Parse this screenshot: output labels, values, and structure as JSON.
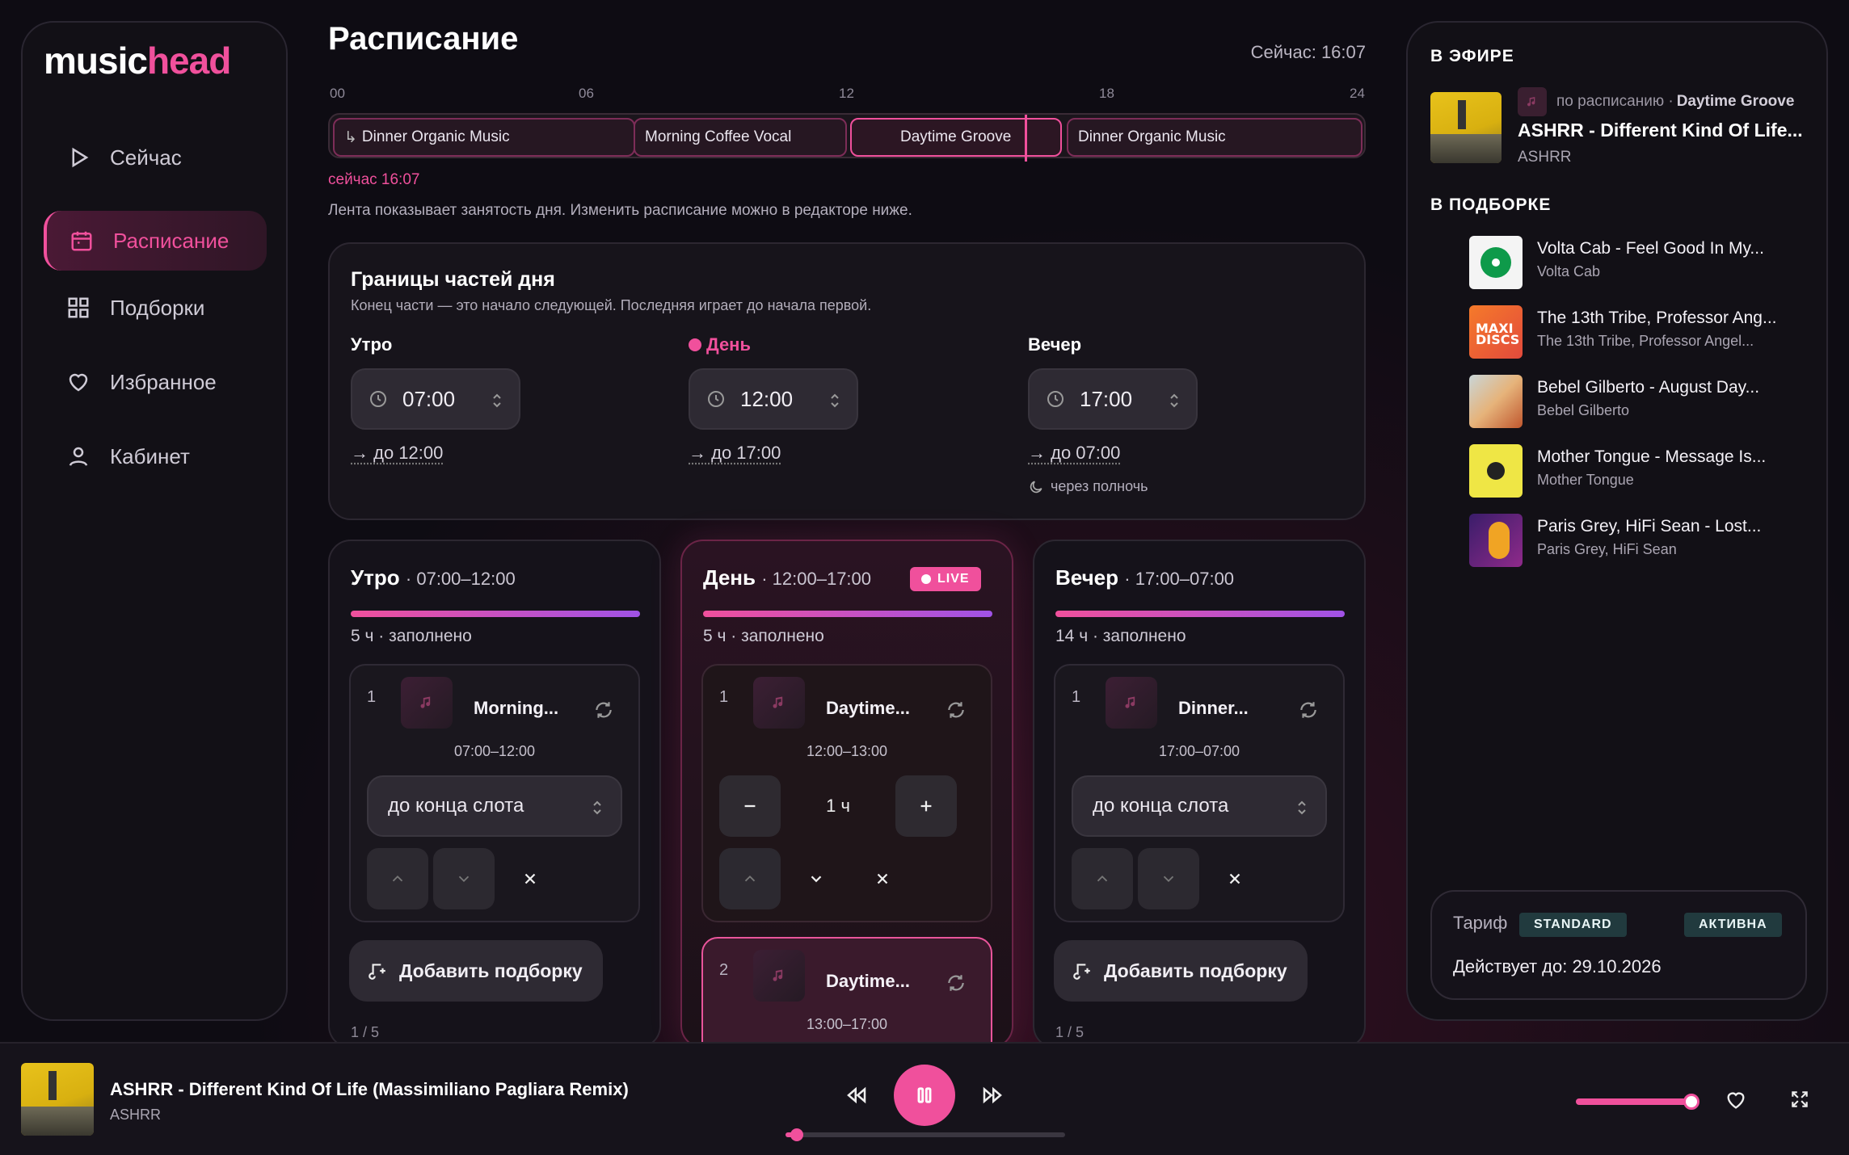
{
  "app": {
    "logo_main": "music",
    "logo_accent": "head"
  },
  "sidebar": {
    "items": [
      {
        "label": "Сейчас",
        "icon": "play-icon"
      },
      {
        "label": "Расписание",
        "icon": "calendar-icon",
        "active": true
      },
      {
        "label": "Подборки",
        "icon": "grid-icon"
      },
      {
        "label": "Избранное",
        "icon": "heart-icon"
      },
      {
        "label": "Кабинет",
        "icon": "user-icon"
      }
    ]
  },
  "header": {
    "title": "Расписание",
    "now": "Сейчас: 16:07"
  },
  "timeline": {
    "ticks": [
      "00",
      "06",
      "12",
      "18",
      "24"
    ],
    "segments": [
      "Dinner Organic Music",
      "Morning Coffee Vocal",
      "Daytime Groove",
      "Dinner Organic Music"
    ],
    "now_label": "сейчас 16:07",
    "hint": "Лента показывает занятость дня. Изменить расписание можно в редакторе ниже.",
    "now_hours": 16.12
  },
  "bounds": {
    "title": "Границы частей дня",
    "subtitle": "Конец части — это начало следующей. Последняя играет до начала первой.",
    "parts": [
      {
        "label": "Утро",
        "time": "07:00",
        "till": "→ до 12:00"
      },
      {
        "label": "День",
        "time": "12:00",
        "till": "→ до 17:00",
        "current": true
      },
      {
        "label": "Вечер",
        "time": "17:00",
        "till": "→ до 07:00",
        "note": "через полночь"
      }
    ]
  },
  "columns": [
    {
      "title": "Утро",
      "range": "· 07:00–12:00",
      "filled": "5 ч · заполнено",
      "item": {
        "num": "1",
        "name": "Morning...",
        "time": "07:00–12:00",
        "select": "до конца слота"
      },
      "add": "Добавить подборку",
      "count": "1 / 5"
    },
    {
      "title": "День",
      "range": "· 12:00–17:00",
      "live": "LIVE",
      "filled": "5 ч · заполнено",
      "item": {
        "num": "1",
        "name": "Daytime...",
        "time": "12:00–13:00",
        "duration": "1 ч"
      },
      "item2": {
        "num": "2",
        "name": "Daytime...",
        "time": "13:00–17:00"
      }
    },
    {
      "title": "Вечер",
      "range": "· 17:00–07:00",
      "filled": "14 ч · заполнено",
      "item": {
        "num": "1",
        "name": "Dinner...",
        "time": "17:00–07:00",
        "select": "до конца слота"
      },
      "add": "Добавить подборку",
      "count": "1 / 5"
    }
  ],
  "on_air": {
    "heading": "В ЭФИРЕ",
    "source_prefix": "по расписанию · ",
    "source": "Daytime Groove",
    "title": "ASHRR - Different Kind Of Life...",
    "artist": "ASHRR"
  },
  "collection": {
    "heading": "В ПОДБОРКЕ",
    "tracks": [
      {
        "title": "Volta Cab - Feel Good In My...",
        "artist": "Volta Cab"
      },
      {
        "title": "The 13th Tribe, Professor Ang...",
        "artist": "The 13th Tribe, Professor Angel..."
      },
      {
        "title": "Bebel Gilberto - August Day...",
        "artist": "Bebel Gilberto"
      },
      {
        "title": "Mother Tongue - Message Is...",
        "artist": "Mother Tongue"
      },
      {
        "title": "Paris Grey, HiFi Sean - Lost...",
        "artist": "Paris Grey, HiFi Sean"
      }
    ]
  },
  "tariff": {
    "label": "Тариф",
    "plan": "STANDARD",
    "status": "АКТИВНА",
    "valid": "Действует до: 29.10.2026"
  },
  "player": {
    "title": "ASHRR - Different Kind Of Life (Massimiliano Pagliara Remix)",
    "artist": "ASHRR",
    "progress": 0.03,
    "volume": 0.98
  },
  "colors": {
    "accent": "#f0509c",
    "accent2": "#a052e6",
    "bg": "#0e0c13"
  }
}
